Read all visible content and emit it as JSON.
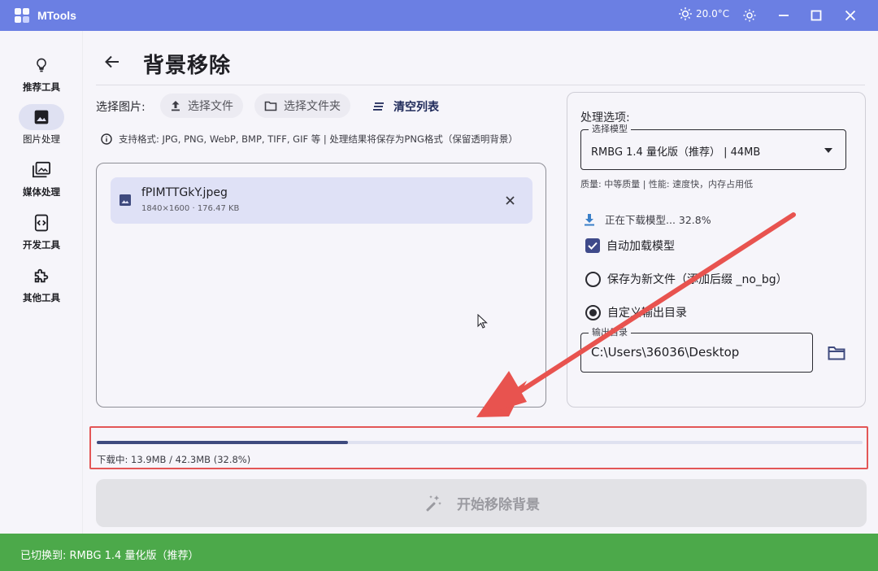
{
  "app": {
    "title": "MTools",
    "weather": "20.0°C"
  },
  "sidebar": {
    "items": [
      {
        "label": "推荐工具",
        "icon": "lightbulb-icon"
      },
      {
        "label": "图片处理",
        "icon": "image-icon",
        "active": true
      },
      {
        "label": "媒体处理",
        "icon": "media-library-icon"
      },
      {
        "label": "开发工具",
        "icon": "code-icon"
      },
      {
        "label": "其他工具",
        "icon": "puzzle-icon"
      }
    ]
  },
  "page": {
    "title": "背景移除"
  },
  "toolbar": {
    "select_label": "选择图片:",
    "select_file": "选择文件",
    "select_folder": "选择文件夹",
    "clear_list": "清空列表"
  },
  "info": "支持格式: JPG, PNG, WebP, BMP, TIFF, GIF 等 | 处理结果将保存为PNG格式（保留透明背景）",
  "files": [
    {
      "name": "fPIMTTGkY.jpeg",
      "meta": "1840×1600 · 176.47 KB"
    }
  ],
  "options": {
    "title": "处理选项:",
    "model_label": "选择模型",
    "model_value": "RMBG 1.4 量化版（推荐） |  44MB",
    "quality": "质量: 中等质量 | 性能: 速度快，内存占用低",
    "download_status": "正在下载模型... 32.8%",
    "auto_load": "自动加载模型",
    "save_new": "保存为新文件（添加后缀 _no_bg）",
    "custom_dir": "自定义输出目录",
    "output_label": "输出目录",
    "output_value": "C:\\Users\\36036\\Desktop"
  },
  "progress": {
    "fraction": 0.328,
    "text": "下载中: 13.9MB / 42.3MB (32.8%)"
  },
  "start_button": "开始移除背景",
  "status_bar": "已切换到: RMBG 1.4 量化版（推荐）",
  "colors": {
    "titlebar": "#6b7fe3",
    "status_bar": "#4ca94a",
    "highlight_box": "#e35656",
    "annotation_arrow": "#e8534f",
    "progress_fill": "#3e4a7e"
  }
}
